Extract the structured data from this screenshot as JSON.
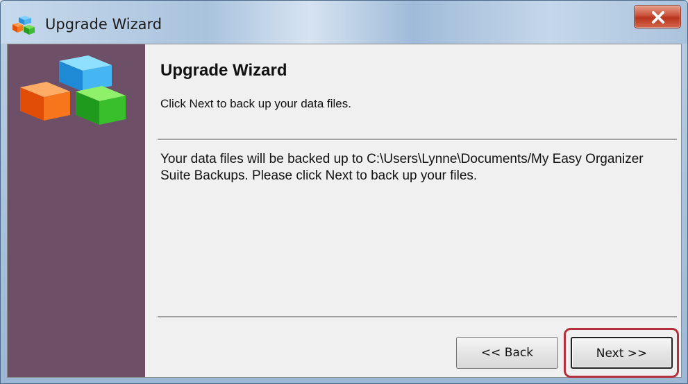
{
  "window": {
    "title": "Upgrade Wizard",
    "app_icon": "colored-blocks-icon",
    "close_icon": "close-x-icon"
  },
  "wizard": {
    "heading": "Upgrade Wizard",
    "subheading": "Click Next to back up your data files.",
    "body": "Your data files will be backed up to C:\\Users\\Lynne\\Documents/My Easy Organizer Suite Backups.  Please click Next to back up your files.",
    "logo_icon": "colored-blocks-logo"
  },
  "buttons": {
    "back_label": "<< Back",
    "next_label": "Next >>"
  },
  "colors": {
    "sidebar": "#6e4f68",
    "highlight": "#b3303c",
    "close_button": "#c9513a"
  }
}
